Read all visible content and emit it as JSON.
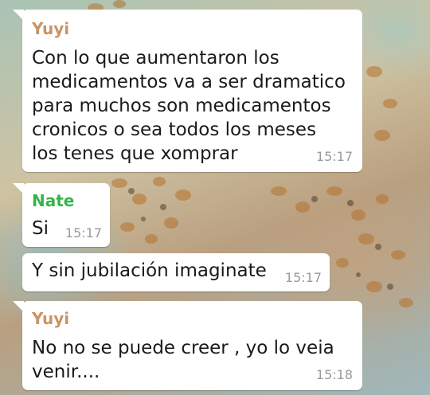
{
  "colors": {
    "sender_yuyi": "#c99467",
    "sender_nate": "#35b44a",
    "bubble": "#ffffff",
    "text": "#1a1a1a",
    "timestamp": "#9a9a9a"
  },
  "messages": [
    {
      "sender": "Yuyi",
      "text": "Con lo que aumentaron los\nmedicamentos va  a ser dramatico\npara muchos son medicamentos\ncronicos o sea todos los meses\nlos tenes que xomprar",
      "time": "15:17"
    },
    {
      "sender": "Nate",
      "text": "Si",
      "time": "15:17"
    },
    {
      "sender": "",
      "text": "Y sin jubilación imaginate",
      "time": "15:17"
    },
    {
      "sender": "Yuyi",
      "text": "No no se puede creer , yo lo veia\nvenir....",
      "time": "15:18"
    }
  ]
}
